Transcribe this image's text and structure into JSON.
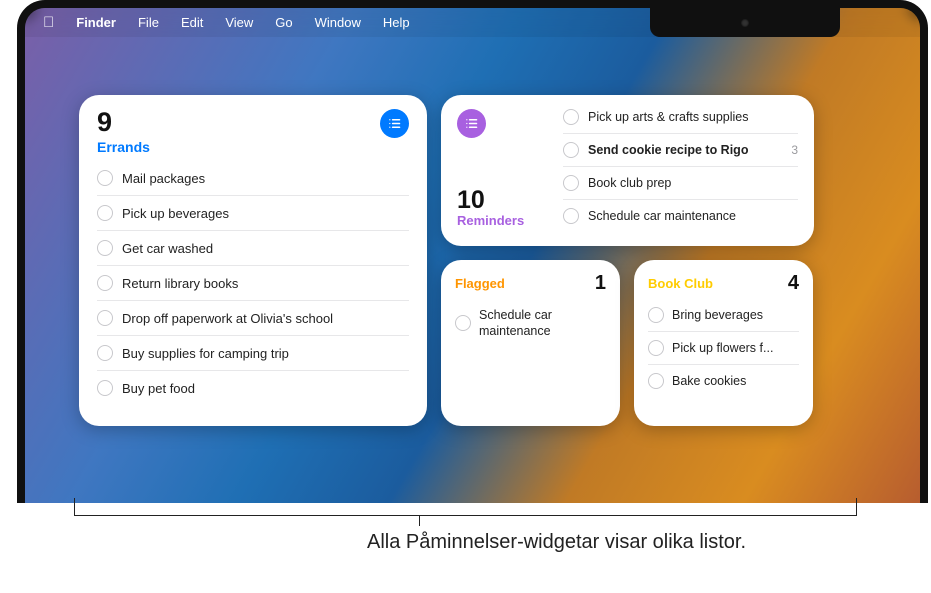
{
  "menubar": {
    "app": "Finder",
    "items": [
      "File",
      "Edit",
      "View",
      "Go",
      "Window",
      "Help"
    ]
  },
  "errands": {
    "count": "9",
    "label": "Errands",
    "color": "#007aff",
    "items": [
      "Mail packages",
      "Pick up beverages",
      "Get car washed",
      "Return library books",
      "Drop off paperwork at Olivia's school",
      "Buy supplies for camping trip",
      "Buy pet food"
    ]
  },
  "reminders": {
    "count": "10",
    "label": "Reminders",
    "color": "#a860e0",
    "items": [
      {
        "t": "Pick up arts & crafts supplies",
        "bold": false,
        "meta": ""
      },
      {
        "t": "Send cookie recipe to Rigo",
        "bold": true,
        "meta": "3"
      },
      {
        "t": "Book club prep",
        "bold": false,
        "meta": ""
      },
      {
        "t": "Schedule car maintenance",
        "bold": false,
        "meta": ""
      }
    ]
  },
  "flagged": {
    "title": "Flagged",
    "count": "1",
    "items": [
      "Schedule car maintenance"
    ]
  },
  "bookclub": {
    "title": "Book Club",
    "count": "4",
    "items": [
      "Bring beverages",
      "Pick up flowers f...",
      "Bake cookies"
    ]
  },
  "caption": "Alla Påminnelser-widgetar visar olika listor."
}
